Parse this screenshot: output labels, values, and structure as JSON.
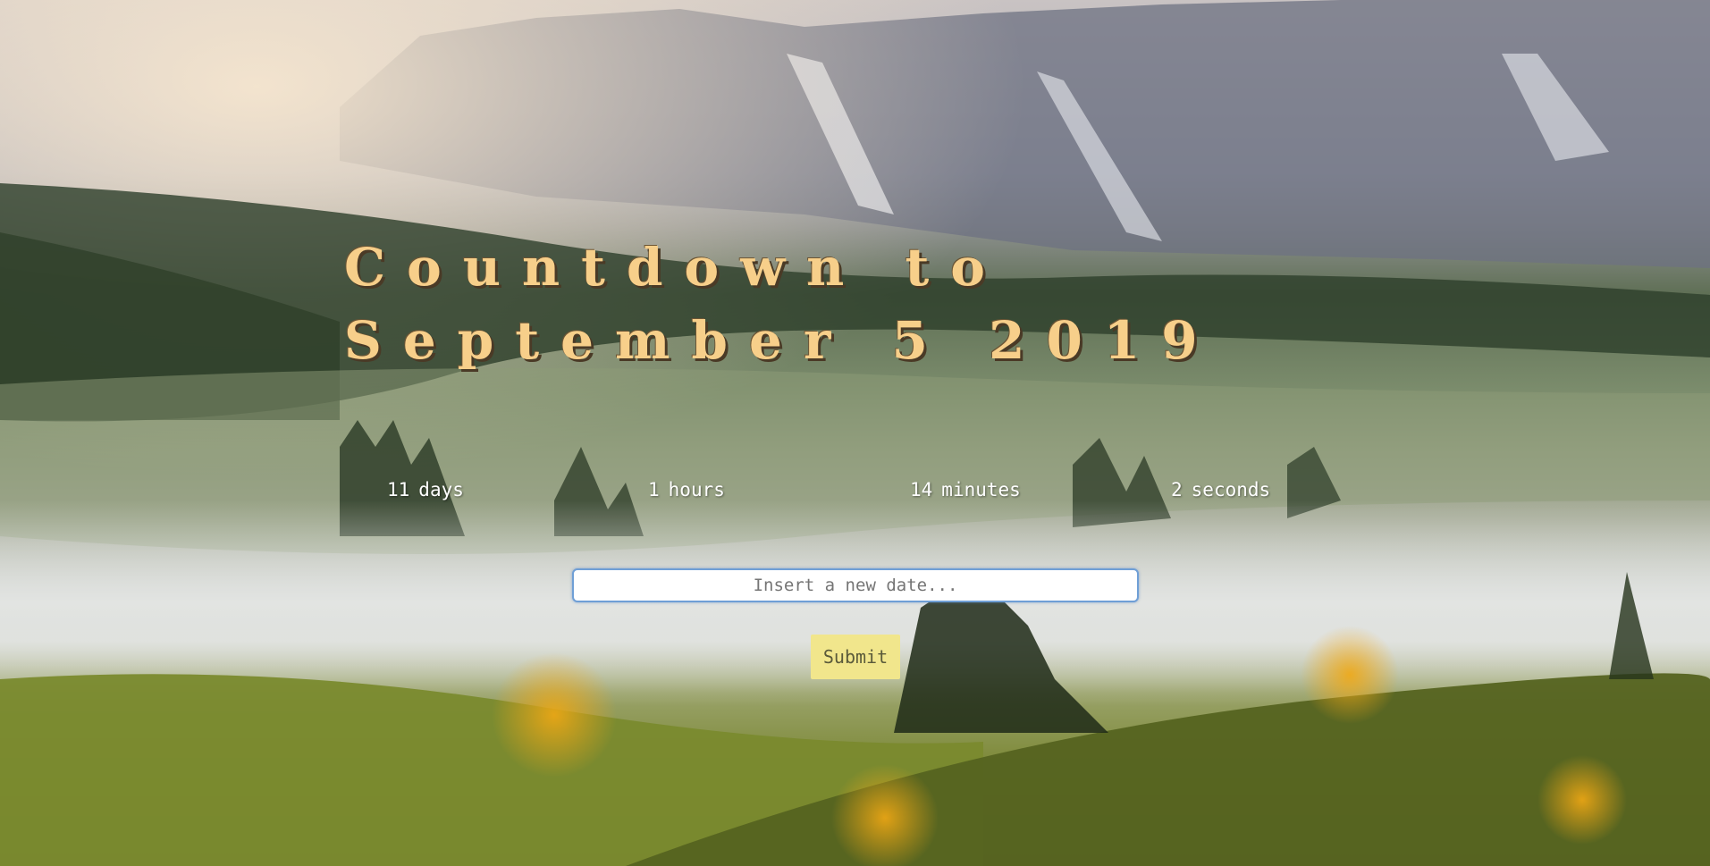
{
  "title": "Countdown to September 5 2019",
  "countdown": {
    "days": {
      "value": "11",
      "unit": "days"
    },
    "hours": {
      "value": "1",
      "unit": "hours"
    },
    "minutes": {
      "value": "14",
      "unit": "minutes"
    },
    "seconds": {
      "value": "2",
      "unit": "seconds"
    }
  },
  "form": {
    "date_placeholder": "Insert a new date...",
    "date_value": "",
    "submit_label": "Submit"
  },
  "colors": {
    "title": "#f7cf8a",
    "submit_bg": "#f1e68c",
    "input_border": "#6f9fd6"
  }
}
